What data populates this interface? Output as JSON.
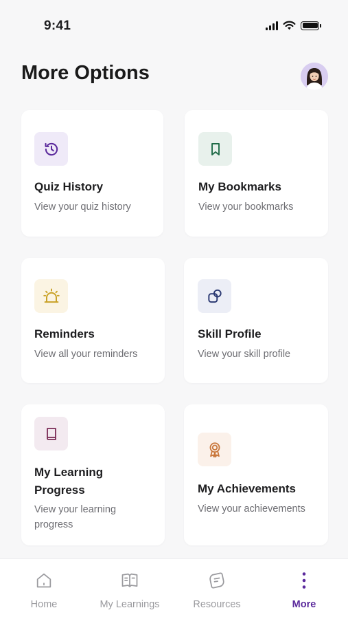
{
  "status_bar": {
    "time": "9:41",
    "icons": [
      "cellular-signal-icon",
      "wifi-icon",
      "battery-icon"
    ]
  },
  "header": {
    "title": "More Options",
    "avatar": "profile-avatar"
  },
  "cards": [
    {
      "id": "quiz-history",
      "title": "Quiz History",
      "subtitle": "View your quiz history",
      "icon": "history-icon",
      "icon_bg": "#efeaf8",
      "icon_color": "#5b2a9c"
    },
    {
      "id": "my-bookmarks",
      "title": "My Bookmarks",
      "subtitle": "View your bookmarks",
      "icon": "bookmark-icon",
      "icon_bg": "#e8f1ec",
      "icon_color": "#1f6b47"
    },
    {
      "id": "reminders",
      "title": "Reminders",
      "subtitle": "View all your reminders",
      "icon": "alarm-icon",
      "icon_bg": "#fbf4e3",
      "icon_color": "#c9a227"
    },
    {
      "id": "skill-profile",
      "title": "Skill Profile",
      "subtitle": "View your skill profile",
      "icon": "shapes-icon",
      "icon_bg": "#eceef6",
      "icon_color": "#2c3a73"
    },
    {
      "id": "learning-progress",
      "title_line1": "My Learning",
      "title_line2": "Progress",
      "subtitle_line1": "View your learning",
      "subtitle_line2": "progress",
      "icon": "book-icon",
      "icon_bg": "#f3eaf0",
      "icon_color": "#7a2a55"
    },
    {
      "id": "my-achievements",
      "title": "My Achievements",
      "subtitle": "View your achievements",
      "icon": "award-icon",
      "icon_bg": "#fbf1ea",
      "icon_color": "#c9773b"
    }
  ],
  "bottom_nav": {
    "items": [
      {
        "label": "Home",
        "icon": "home-icon",
        "active": false
      },
      {
        "label": "My Learnings",
        "icon": "open-book-icon",
        "active": false
      },
      {
        "label": "Resources",
        "icon": "resources-icon",
        "active": false
      },
      {
        "label": "More",
        "icon": "more-vertical-icon",
        "active": true
      }
    ],
    "inactive_color": "#9a9a9e",
    "active_color": "#5b2a9c"
  }
}
